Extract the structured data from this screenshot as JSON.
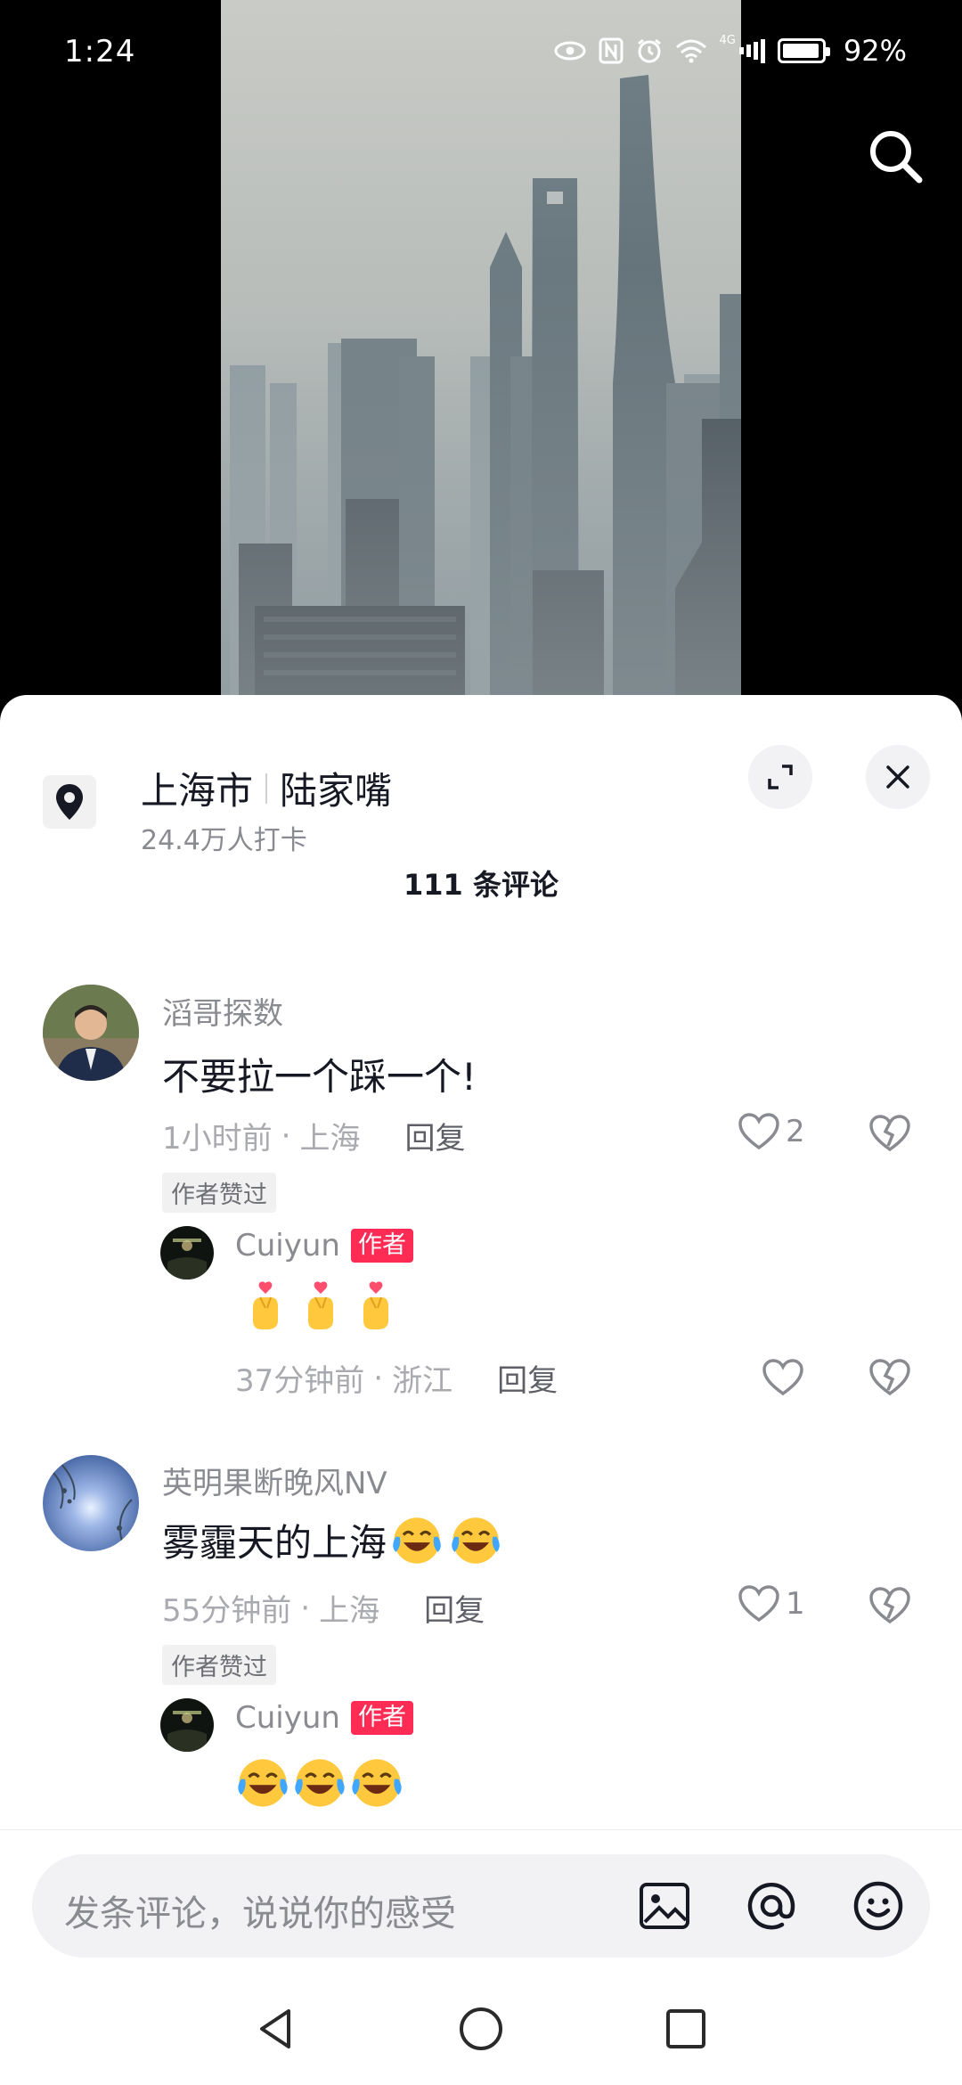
{
  "status": {
    "time": "1:24",
    "battery": "92%",
    "network": "4G",
    "battery_level": 0.92
  },
  "location": {
    "city": "上海市",
    "place": "陆家嘴",
    "checkins": "24.4万人打卡"
  },
  "comments_header": "111 条评论",
  "comments": [
    {
      "username": "滔哥探数",
      "text": "不要拉一个踩一个!",
      "time": "1小时前",
      "region": "上海",
      "reply_label": "回复",
      "likes": "2",
      "liked_tag": "作者赞过",
      "reply": {
        "username": "Cuiyun",
        "badge": "作者",
        "emojis": [
          "finger-heart-icon",
          "finger-heart-icon",
          "finger-heart-icon"
        ],
        "time": "37分钟前",
        "region": "浙江",
        "reply_label": "回复"
      }
    },
    {
      "username": "英明果断晚风NV",
      "text": "雾霾天的上海",
      "emojis": [
        "laughing-crying-icon",
        "laughing-crying-icon"
      ],
      "time": "55分钟前",
      "region": "上海",
      "reply_label": "回复",
      "likes": "1",
      "liked_tag": "作者赞过",
      "reply": {
        "username": "Cuiyun",
        "badge": "作者",
        "emojis": [
          "laughing-crying-icon",
          "laughing-crying-icon",
          "laughing-crying-icon"
        ]
      }
    }
  ],
  "input": {
    "placeholder": "发条评论，说说你的感受"
  },
  "colors": {
    "accent": "#fe2c55",
    "text_primary": "#161823",
    "text_secondary": "#8a8b91"
  }
}
